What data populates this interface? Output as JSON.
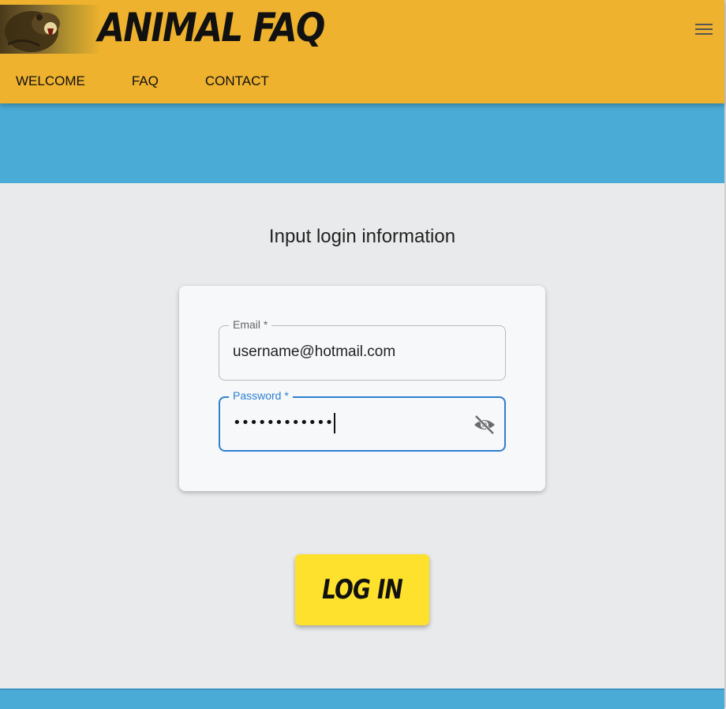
{
  "header": {
    "brand": "ANIMAL FAQ",
    "nav": [
      "WELCOME",
      "FAQ",
      "CONTACT"
    ],
    "logo_icon": "bear-logo",
    "menu_icon": "hamburger-menu-icon"
  },
  "main": {
    "heading": "Input login information",
    "form": {
      "email_label": "Email *",
      "email_value": "username@hotmail.com",
      "password_label": "Password *",
      "password_value": "••••••••••••",
      "visibility_icon": "eye-off-icon"
    },
    "login_button": "LOG IN"
  },
  "colors": {
    "header": "#eeb22e",
    "band": "#4aabd6",
    "background": "#e9eaeb",
    "button": "#fde12d",
    "focus": "#2f7fd0"
  }
}
